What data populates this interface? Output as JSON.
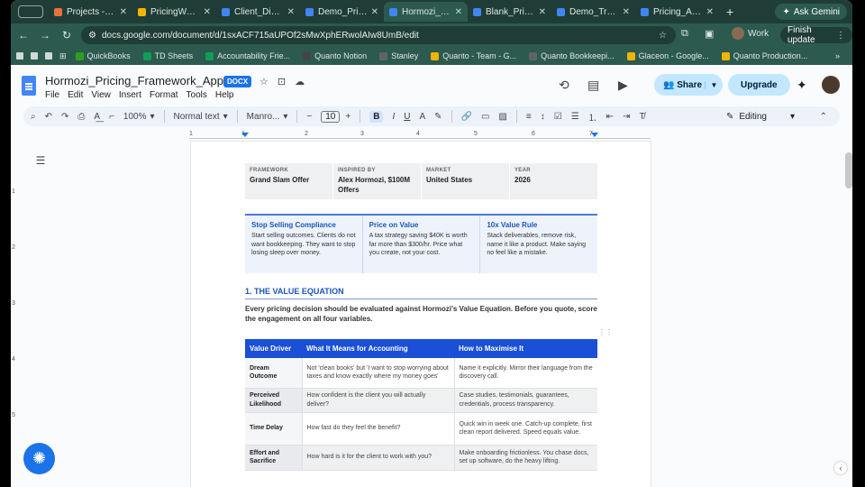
{
  "browser": {
    "tabs": [
      {
        "title": "Projects - Cla",
        "color": "#e8713c",
        "active": false
      },
      {
        "title": "PricingWorksh",
        "color": "#f4b400",
        "active": false
      },
      {
        "title": "Client_Discov",
        "color": "#4285f4",
        "active": false
      },
      {
        "title": "Demo_Pricing",
        "color": "#4285f4",
        "active": false
      },
      {
        "title": "Hormozi_Pric",
        "color": "#4285f4",
        "active": true
      },
      {
        "title": "Blank_Pricing",
        "color": "#4285f4",
        "active": false
      },
      {
        "title": "Demo_Transc",
        "color": "#4285f4",
        "active": false
      },
      {
        "title": "Pricing_Autor",
        "color": "#4285f4",
        "active": false
      }
    ],
    "ask_gemini": "Ask Gemini",
    "url": "docs.google.com/document/d/1sxACF715aUPOf2sMwXphERwolAIw8UmB/edit",
    "profile": "Work",
    "finish_update": "Finish update",
    "bookmarks": [
      {
        "label": "QuickBooks",
        "color": "#2ca01c"
      },
      {
        "label": "TD Sheets",
        "color": "#0f9d58"
      },
      {
        "label": "Accountability Frie...",
        "color": "#0f9d58"
      },
      {
        "label": "Quanto Notion",
        "color": "#444444"
      },
      {
        "label": "Stanley",
        "color": "#5f6368"
      },
      {
        "label": "Quanto - Team - G...",
        "color": "#f4b400"
      },
      {
        "label": "Quanto Bookkeepi...",
        "color": "#5f6368"
      },
      {
        "label": "Glaceon - Google...",
        "color": "#f4b400"
      },
      {
        "label": "Quanto Production...",
        "color": "#f4b400"
      }
    ]
  },
  "docs": {
    "title": "Hormozi_Pricing_Framework_Applied",
    "badge": "DOCX",
    "menus": [
      "File",
      "Edit",
      "View",
      "Insert",
      "Format",
      "Tools",
      "Help"
    ],
    "share": "Share",
    "upgrade": "Upgrade",
    "toolbar": {
      "zoom": "100%",
      "style": "Normal text",
      "font": "Manro...",
      "size": "10",
      "mode": "Editing"
    },
    "ruler": [
      "1",
      "1",
      "2",
      "3",
      "4",
      "5",
      "6",
      "7"
    ],
    "vruler": [
      "1",
      "2",
      "3",
      "4",
      "5"
    ]
  },
  "doc": {
    "meta": [
      {
        "label": "FRAMEWORK",
        "value": "Grand Slam Offer"
      },
      {
        "label": "INSPIRED BY",
        "value": "Alex Hormozi, $100M Offers"
      },
      {
        "label": "MARKET",
        "value": "United States"
      },
      {
        "label": "YEAR",
        "value": "2026"
      }
    ],
    "principles": [
      {
        "title": "Stop Selling Compliance",
        "body": "Start selling outcomes. Clients do not want bookkeeping. They want to stop losing sleep over money."
      },
      {
        "title": "Price on Value",
        "body": "A tax strategy saving $40K is worth far more than $300/hr. Price what you create, not your cost."
      },
      {
        "title": "10x Value Rule",
        "body": "Stack deliverables, remove risk, name it like a product. Make saying no feel like a mistake."
      }
    ],
    "section_heading": "1. THE VALUE EQUATION",
    "intro": "Every pricing decision should be evaluated against Hormozi's Value Equation. Before you quote, score the engagement on all four variables.",
    "table": {
      "headers": [
        "Value Driver",
        "What It Means for Accounting",
        "How to Maximise It"
      ],
      "rows": [
        [
          "Dream Outcome",
          "Not 'clean books' but 'I want to stop worrying about taxes and know exactly where my money goes'",
          "Name it explicitly. Mirror their language from the discovery call."
        ],
        [
          "Perceived Likelihood",
          "How confident is the client you will actually deliver?",
          "Case studies, testimonials, guarantees, credentials, process transparency."
        ],
        [
          "Time Delay",
          "How fast do they feel the benefit?",
          "Quick win in week one. Catch-up complete, first clean report delivered. Speed equals value."
        ],
        [
          "Effort and Sacrifice",
          "How hard is it for the client to work with you?",
          "Make onboarding frictionless. You chase docs, set up software, do the heavy lifting."
        ]
      ]
    }
  }
}
